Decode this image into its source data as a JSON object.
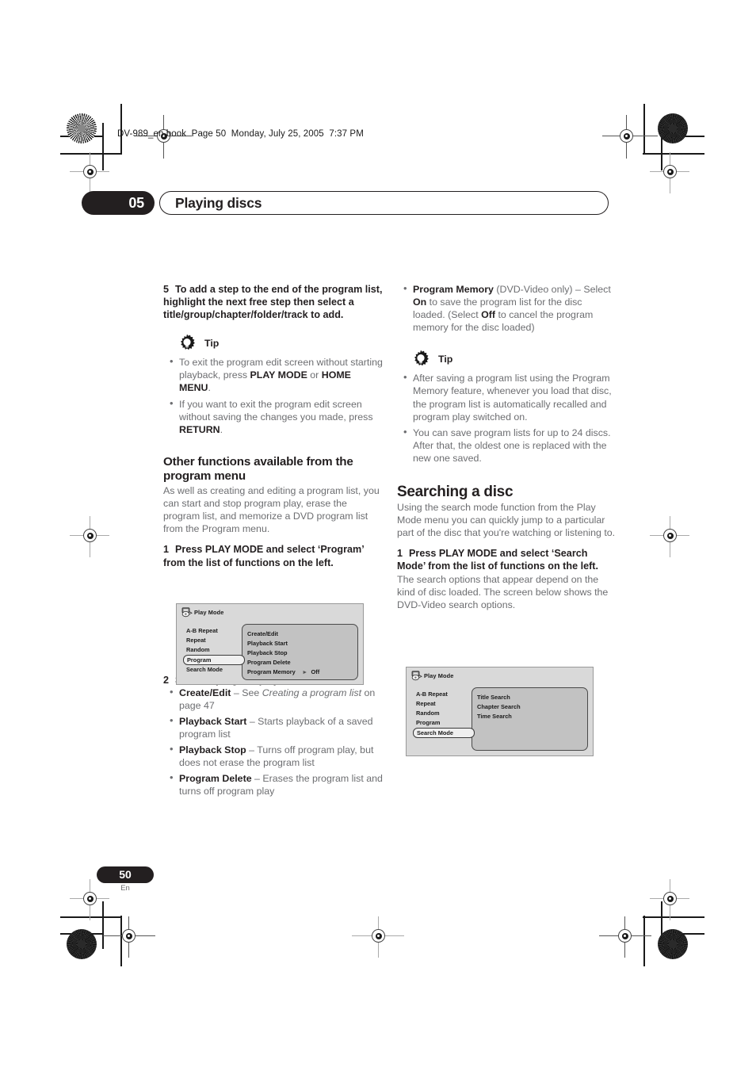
{
  "header": {
    "running_head": "DV-989_en.book  Page 50  Monday, July 25, 2005  7:37 PM",
    "chapter_number": "05",
    "chapter_title": "Playing discs"
  },
  "footer": {
    "page_number": "50",
    "language_code": "En"
  },
  "left_column": {
    "step5": {
      "num": "5",
      "text": "To add a step to the end of the program list, highlight the next free step then select a title/group/chapter/folder/track to add."
    },
    "tip1": {
      "label": "Tip",
      "icon": "tip-gear-bulb-icon",
      "bullets": [
        {
          "parts": [
            {
              "t": "To exit the program edit screen without starting playback, press ",
              "style": "normal"
            },
            {
              "t": "PLAY MODE",
              "style": "bold"
            },
            {
              "t": " or ",
              "style": "normal"
            },
            {
              "t": "HOME MENU",
              "style": "bold"
            },
            {
              "t": ".",
              "style": "normal"
            }
          ]
        },
        {
          "parts": [
            {
              "t": "If you want to exit the program edit screen without saving the changes you made, press ",
              "style": "normal"
            },
            {
              "t": "RETURN",
              "style": "bold"
            },
            {
              "t": ".",
              "style": "normal"
            }
          ]
        }
      ]
    },
    "heading": "Other functions available from the program menu",
    "intro": "As well as creating and editing a program list, you can start and stop program play, erase the program list, and memorize a DVD program list from the Program menu.",
    "step1": {
      "num": "1",
      "text": "Press PLAY MODE and select ‘Program’ from the list of functions on the left."
    },
    "osd_program": {
      "title": "Play Mode",
      "icon": "play-mode-disc-icon",
      "menu_items": [
        {
          "label": "A-B Repeat",
          "selected": false
        },
        {
          "label": "Repeat",
          "selected": false
        },
        {
          "label": "Random",
          "selected": false
        },
        {
          "label": "Program",
          "selected": true
        },
        {
          "label": "Search Mode",
          "selected": false
        }
      ],
      "panel_items": [
        {
          "label": "Create/Edit",
          "value": ""
        },
        {
          "label": "Playback Start",
          "value": ""
        },
        {
          "label": "Playback Stop",
          "value": ""
        },
        {
          "label": "Program Delete",
          "value": ""
        },
        {
          "label": "Program Memory",
          "value": "Off",
          "arrow": "▸"
        }
      ]
    },
    "step2": {
      "num": "2",
      "text": "Select a program play function."
    },
    "function_bullets": [
      {
        "parts": [
          {
            "t": "Create/Edit",
            "style": "bold"
          },
          {
            "t": " – See ",
            "style": "normal"
          },
          {
            "t": "Creating a program list",
            "style": "italic"
          },
          {
            "t": " on page 47",
            "style": "normal"
          }
        ]
      },
      {
        "parts": [
          {
            "t": "Playback Start",
            "style": "bold"
          },
          {
            "t": " – Starts playback of a saved program list",
            "style": "normal"
          }
        ]
      },
      {
        "parts": [
          {
            "t": "Playback Stop",
            "style": "bold"
          },
          {
            "t": " – Turns off program play, but does not erase the program list",
            "style": "normal"
          }
        ]
      },
      {
        "parts": [
          {
            "t": "Program Delete",
            "style": "bold"
          },
          {
            "t": " – Erases the program list and turns off program play",
            "style": "normal"
          }
        ]
      }
    ]
  },
  "right_column": {
    "program_memory_bullet": {
      "parts": [
        {
          "t": "Program Memory",
          "style": "bold"
        },
        {
          "t": " (DVD-Video only) – Select ",
          "style": "normal"
        },
        {
          "t": "On",
          "style": "bold"
        },
        {
          "t": " to save the program list for the disc loaded. (Select ",
          "style": "normal"
        },
        {
          "t": "Off",
          "style": "bold"
        },
        {
          "t": " to cancel the program memory for the disc loaded)",
          "style": "normal"
        }
      ]
    },
    "tip2": {
      "label": "Tip",
      "icon": "tip-gear-bulb-icon",
      "bullets": [
        {
          "parts": [
            {
              "t": "After saving a program list using the Program Memory feature, whenever you load that disc, the program list is automatically recalled and program play switched on.",
              "style": "normal"
            }
          ]
        },
        {
          "parts": [
            {
              "t": "You can save program lists for up to 24 discs. After that, the oldest one is replaced with the new one saved.",
              "style": "normal"
            }
          ]
        }
      ]
    },
    "heading": "Searching a disc",
    "intro": "Using the search mode function from the Play Mode menu you can quickly jump to a particular part of the disc that you're watching or listening to.",
    "step1": {
      "num": "1",
      "text": "Press PLAY MODE and select ‘Search Mode’ from the list of functions on the left."
    },
    "after_step1": "The search options that appear depend on the kind of disc loaded. The screen below shows the DVD-Video search options.",
    "osd_search": {
      "title": "Play Mode",
      "icon": "play-mode-disc-icon",
      "menu_items": [
        {
          "label": "A-B Repeat",
          "selected": false
        },
        {
          "label": "Repeat",
          "selected": false
        },
        {
          "label": "Random",
          "selected": false
        },
        {
          "label": "Program",
          "selected": false
        },
        {
          "label": "Search Mode",
          "selected": true
        }
      ],
      "panel_items": [
        {
          "label": "Title Search",
          "value": ""
        },
        {
          "label": "Chapter Search",
          "value": ""
        },
        {
          "label": "Time Search",
          "value": ""
        }
      ]
    }
  },
  "colors": {
    "ink": "#231f20",
    "body_gray": "#6d6e71",
    "osd_bg": "#d9d9d9",
    "osd_panel": "#c2c2c2"
  }
}
